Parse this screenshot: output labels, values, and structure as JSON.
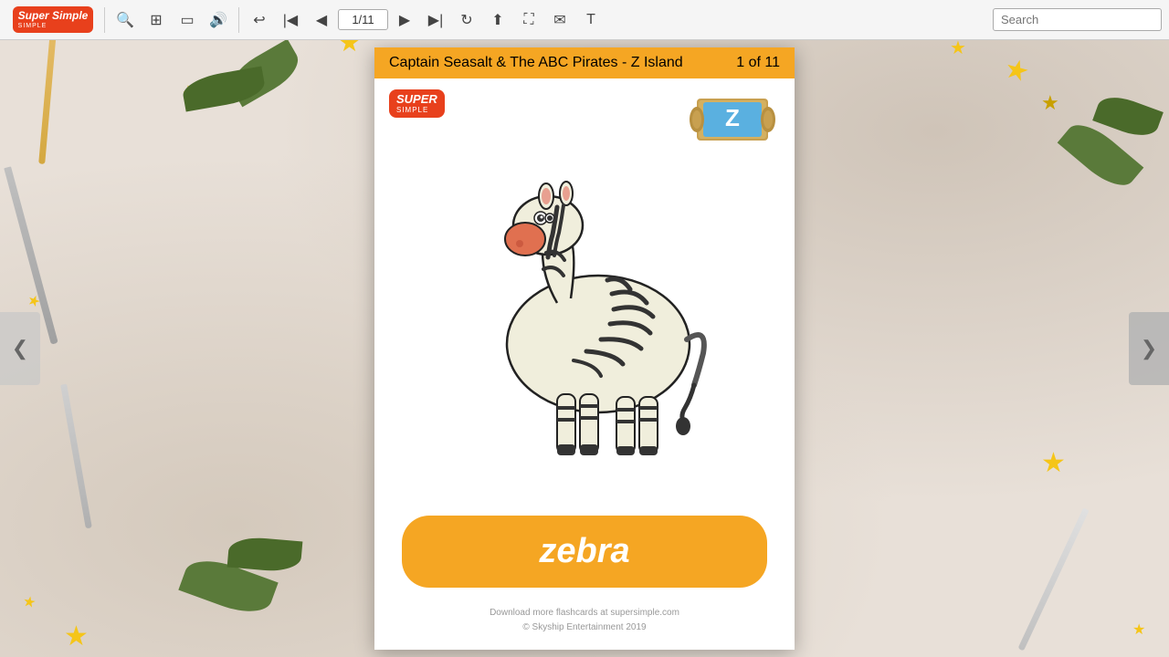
{
  "app": {
    "title": "Super Simple"
  },
  "toolbar": {
    "zoom_in": "🔍",
    "grid": "⊞",
    "fit_page": "⬜",
    "audio": "🔊",
    "step_back": "↩",
    "first_page": "⏮",
    "prev_page": "←",
    "page_current": "1",
    "page_total": "11",
    "page_indicator": "1/11",
    "next_page": "→",
    "last_page": "⏭",
    "rotate": "↻",
    "share": "⬆",
    "fullscreen": "⛶",
    "email": "✉",
    "text": "T",
    "search_placeholder": "Search"
  },
  "navigation": {
    "prev_arrow": "❮",
    "next_arrow": "❯"
  },
  "flashcard": {
    "header_title": "Captain Seasalt & The ABC Pirates - Z Island",
    "page_indicator": "1 of 11",
    "logo_super": "SUPER",
    "logo_simple": "SIMPLE",
    "z_letter": "Z",
    "word": "zebra",
    "footer_line1": "Download more flashcards at supersimple.com",
    "footer_line2": "© Skyship Entertainment 2019"
  },
  "colors": {
    "orange": "#f5a623",
    "red": "#e8401c",
    "star_yellow": "#f5c518",
    "card_bg": "#ffffff"
  }
}
